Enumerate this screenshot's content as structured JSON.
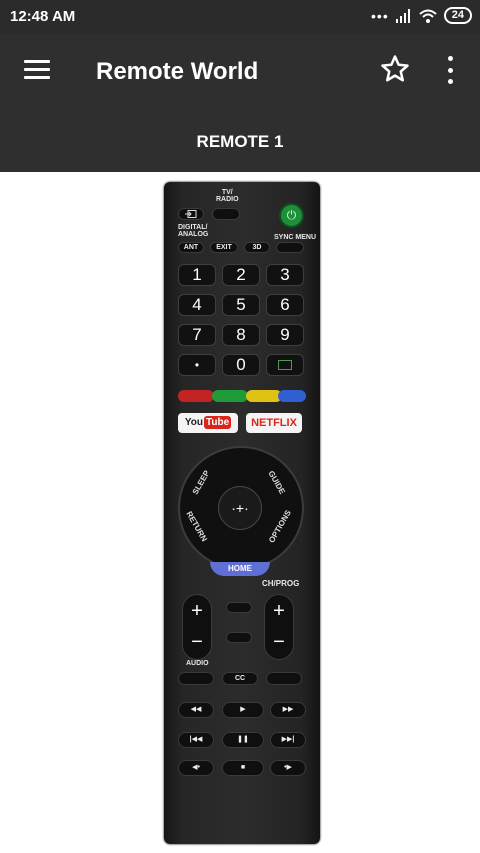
{
  "status_bar": {
    "time": "12:48 AM",
    "signal_dots": "•••",
    "battery": "24"
  },
  "app_bar": {
    "title": "Remote World",
    "menu_icon": "hamburger-icon",
    "favorite_icon": "star-icon",
    "overflow_icon": "more-vertical-icon"
  },
  "tab": {
    "label": "REMOTE 1"
  },
  "remote": {
    "tv_radio": "TV/\nRADIO",
    "digital_analog": "DIGITAL/\nANALOG",
    "sync_menu": "SYNC MENU",
    "top_buttons": [
      "ANT",
      "EXIT",
      "3D"
    ],
    "numbers": [
      "1",
      "2",
      "3",
      "4",
      "5",
      "6",
      "7",
      "8",
      "9",
      "•",
      "0"
    ],
    "colors": [
      "#c22424",
      "#1f9b3a",
      "#e0c214",
      "#2f5fd0"
    ],
    "youtube_text": "You",
    "youtube_badge": "Tube",
    "netflix": "NETFLIX",
    "sleep": "SLEEP",
    "guide": "GUIDE",
    "return": "RETURN",
    "options": "OPTIONS",
    "home": "HOME",
    "ch_prog": "CH/PROG",
    "plus": "+",
    "minus": "−",
    "audio": "AUDIO",
    "cc": "CC",
    "center_symbol": "·+·",
    "transport_row1": [
      "◀◀",
      "▶",
      "▶▶"
    ],
    "transport_row2": [
      "|◀◀",
      "❚❚",
      "▶▶|"
    ],
    "transport_row3": [
      "◀•",
      "■",
      "•▶"
    ]
  }
}
